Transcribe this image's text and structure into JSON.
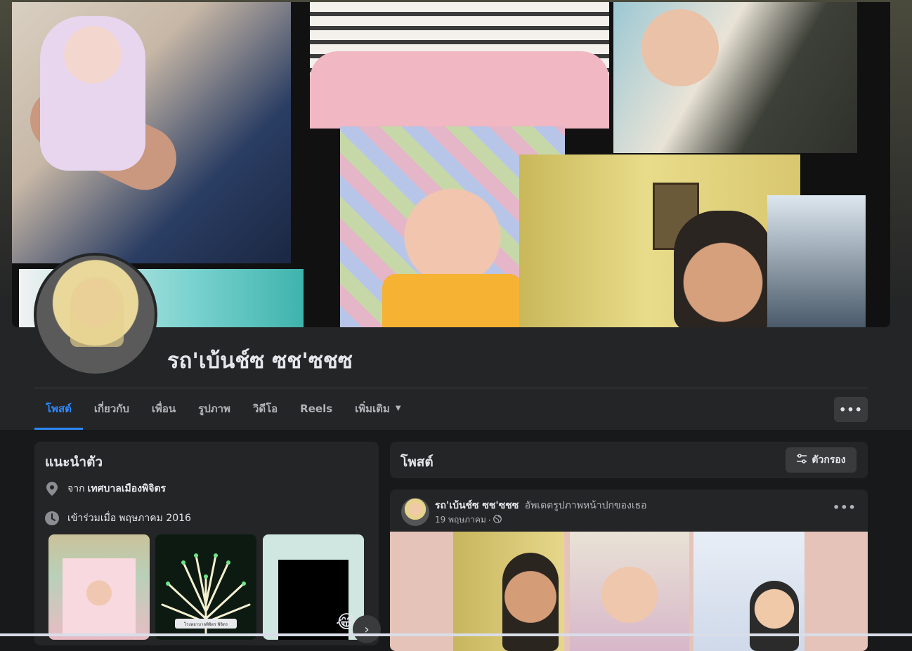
{
  "profile": {
    "name": "รถ'เบ้นช์ซ ซช'ซชซ"
  },
  "tabs": [
    {
      "label": "โพสต์",
      "active": true
    },
    {
      "label": "เกี่ยวกับ",
      "active": false
    },
    {
      "label": "เพื่อน",
      "active": false
    },
    {
      "label": "รูปภาพ",
      "active": false
    },
    {
      "label": "วิดีโอ",
      "active": false
    },
    {
      "label": "Reels",
      "active": false
    },
    {
      "label": "เพิ่มเติม",
      "active": false
    }
  ],
  "more_button": {
    "label": "•••"
  },
  "intro": {
    "title": "แนะนำตัว",
    "location_prefix": "จาก",
    "location_value": "เทศบาลเมืองพิจิตร",
    "joined_prefix": "เข้าร่วมเมื่อ",
    "joined_value": "พฤษภาคม 2016",
    "photo_caption": "โรงพยาบาลพิจิตร พิจิตร"
  },
  "posts_section": {
    "title": "โพสต์",
    "filter_label": "ตัวกรอง"
  },
  "post": {
    "author": "รถ'เบ้นช์ซ ซช'ซชซ",
    "action": "อัพเดตรูปภาพหน้าปกของเธอ",
    "date": "19 พฤษภาคม",
    "dot": "·",
    "menu": "•••"
  },
  "colors": {
    "accent": "#2d88ff",
    "surface": "#242526",
    "background": "#18191a",
    "button": "#3a3b3c"
  },
  "icons": {
    "location": "map-pin-icon",
    "clock": "clock-icon",
    "filter": "sliders-icon",
    "globe": "globe-icon",
    "caret": "caret-down-icon",
    "next": "chevron-right-icon"
  }
}
